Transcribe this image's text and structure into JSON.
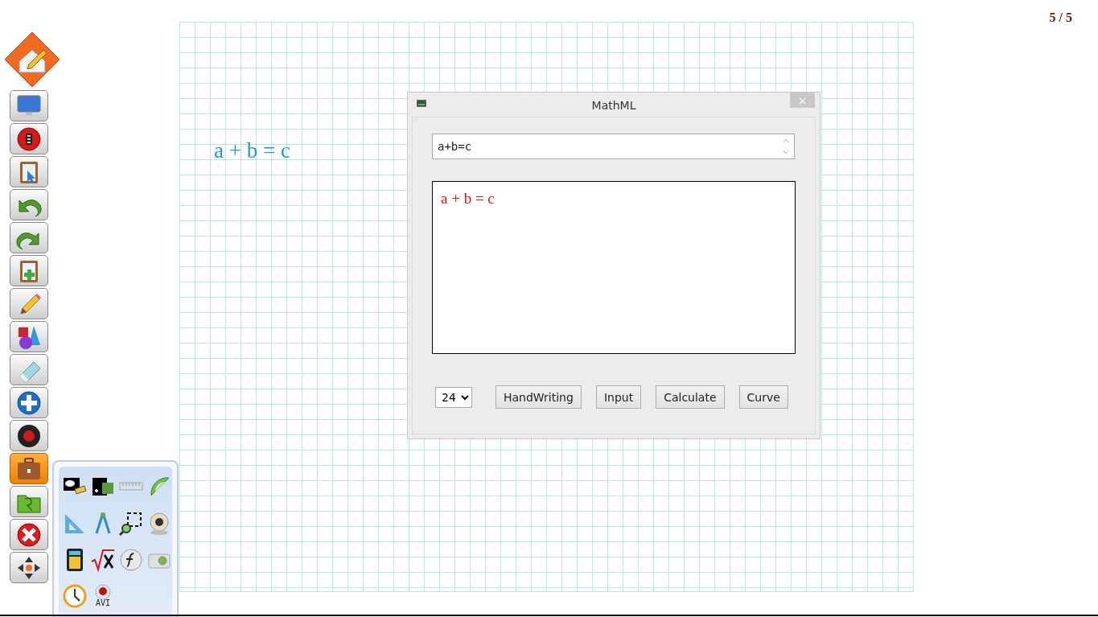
{
  "page_counter": "5 / 5",
  "toolbar": [
    {
      "selected": false
    },
    {
      "selected": false
    },
    {
      "selected": false
    },
    {
      "selected": false
    },
    {
      "selected": false
    },
    {
      "selected": false
    },
    {
      "selected": false
    },
    {
      "selected": false
    },
    {
      "selected": false
    },
    {
      "selected": false
    },
    {
      "selected": false
    },
    {
      "selected": true
    },
    {
      "selected": false
    },
    {
      "selected": false
    },
    {
      "selected": false
    }
  ],
  "tool_palette": {
    "avi_label": "AVI"
  },
  "canvas": {
    "formula": "a + b = c"
  },
  "dialog": {
    "title": "MathML",
    "close": "×",
    "expression_input": {
      "value": "a+b=c"
    },
    "rendered_output": "a + b = c",
    "font_size": {
      "value": "24"
    },
    "buttons": [
      "HandWriting",
      "Input",
      "Calculate",
      "Curve"
    ]
  }
}
